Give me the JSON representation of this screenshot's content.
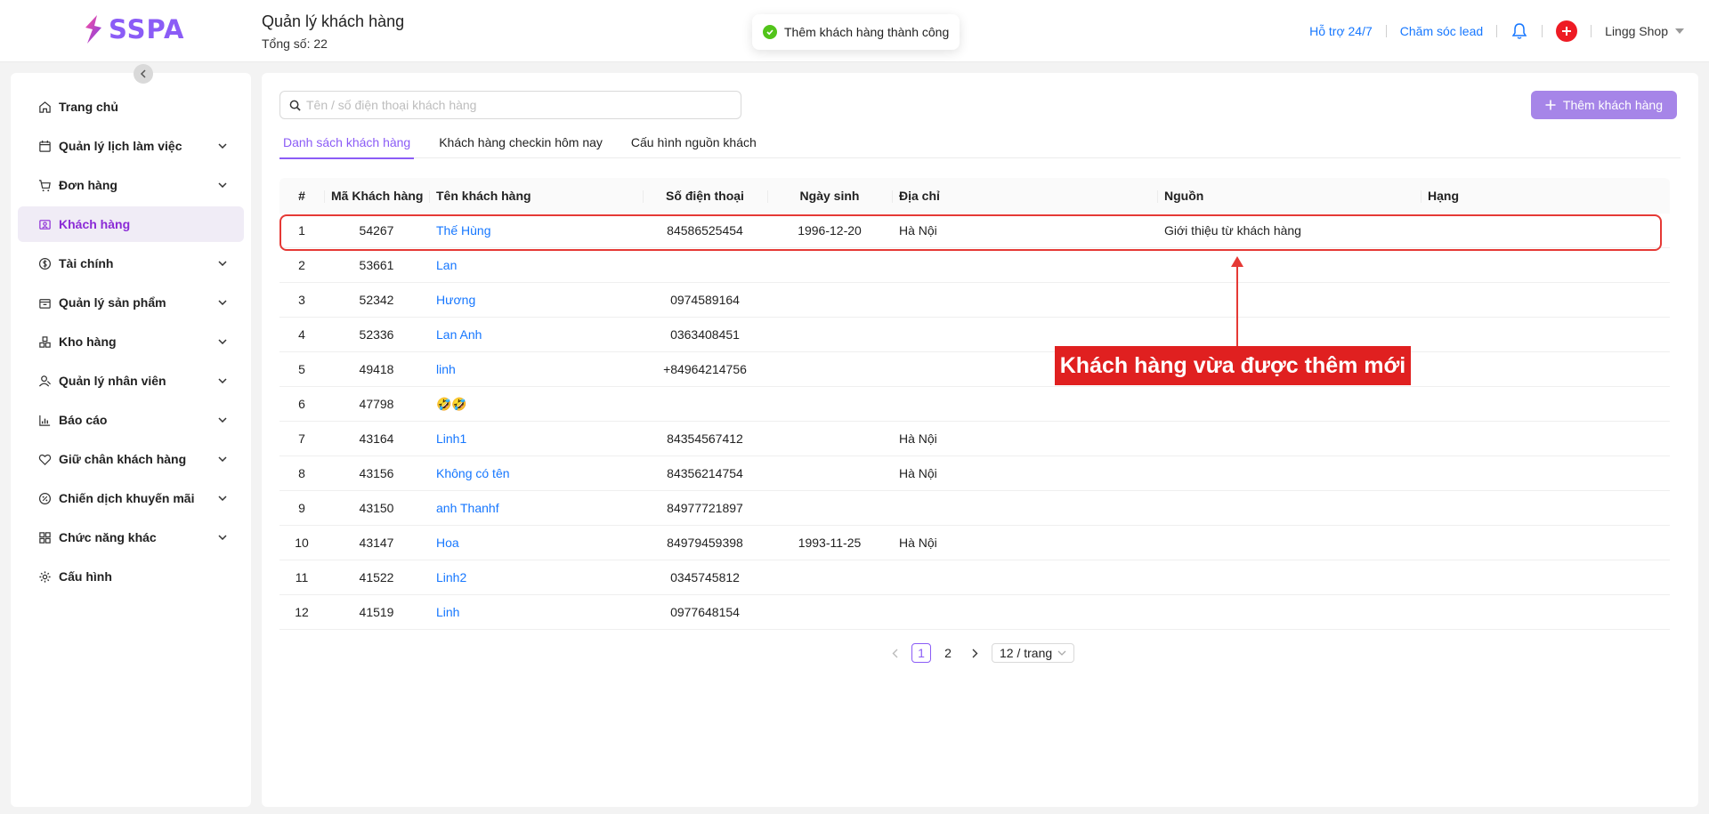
{
  "brand": {
    "name": "SSPA"
  },
  "header": {
    "title": "Quản lý khách hàng",
    "subtitle": "Tổng số: 22",
    "toast": "Thêm khách hàng thành công",
    "support_link": "Hỗ trợ 24/7",
    "lead_link": "Chăm sóc lead",
    "shop_name": "Lingg Shop"
  },
  "sidebar": {
    "items": [
      {
        "label": "Trang chủ",
        "icon": "home-icon"
      },
      {
        "label": "Quản lý lịch làm việc",
        "icon": "calendar-icon"
      },
      {
        "label": "Đơn hàng",
        "icon": "cart-icon"
      },
      {
        "label": "Khách hàng",
        "icon": "contact-icon"
      },
      {
        "label": "Tài chính",
        "icon": "dollar-icon"
      },
      {
        "label": "Quản lý sản phẩm",
        "icon": "box-icon"
      },
      {
        "label": "Kho hàng",
        "icon": "warehouse-icon"
      },
      {
        "label": "Quản lý nhân viên",
        "icon": "user-icon"
      },
      {
        "label": "Báo cáo",
        "icon": "chart-icon"
      },
      {
        "label": "Giữ chân khách hàng",
        "icon": "heart-icon"
      },
      {
        "label": "Chiến dịch khuyến mãi",
        "icon": "discount-icon"
      },
      {
        "label": "Chức năng khác",
        "icon": "grid-icon"
      },
      {
        "label": "Cấu hình",
        "icon": "gear-icon"
      }
    ]
  },
  "search": {
    "placeholder": "Tên / số điện thoại khách hàng"
  },
  "add_button": "Thêm khách hàng",
  "tabs": [
    {
      "label": "Danh sách khách hàng"
    },
    {
      "label": "Khách hàng checkin hôm nay"
    },
    {
      "label": "Cấu hình nguồn khách"
    }
  ],
  "table": {
    "columns": [
      "#",
      "Mã Khách hàng",
      "Tên khách hàng",
      "Số điện thoại",
      "Ngày sinh",
      "Địa chỉ",
      "Nguồn",
      "Hạng"
    ],
    "rows": [
      [
        "1",
        "54267",
        "Thế Hùng",
        "84586525454",
        "1996-12-20",
        "Hà Nội",
        "Giới thiệu từ khách hàng",
        ""
      ],
      [
        "2",
        "53661",
        "Lan",
        "",
        "",
        "",
        "",
        ""
      ],
      [
        "3",
        "52342",
        "Hương",
        "0974589164",
        "",
        "",
        "",
        ""
      ],
      [
        "4",
        "52336",
        "Lan Anh",
        "0363408451",
        "",
        "",
        "",
        ""
      ],
      [
        "5",
        "49418",
        "linh",
        "+84964214756",
        "",
        "",
        "",
        ""
      ],
      [
        "6",
        "47798",
        "🤣🤣",
        "",
        "",
        "",
        "",
        ""
      ],
      [
        "7",
        "43164",
        "Linh1",
        "84354567412",
        "",
        "Hà Nội",
        "",
        ""
      ],
      [
        "8",
        "43156",
        "Không có tên",
        "84356214754",
        "",
        "Hà Nội",
        "",
        ""
      ],
      [
        "9",
        "43150",
        "anh Thanhf",
        "84977721897",
        "",
        "",
        "",
        ""
      ],
      [
        "10",
        "43147",
        "Hoa",
        "84979459398",
        "1993-11-25",
        "Hà Nội",
        "",
        ""
      ],
      [
        "11",
        "41522",
        "Linh2",
        "0345745812",
        "",
        "",
        "",
        ""
      ],
      [
        "12",
        "41519",
        "Linh",
        "0977648154",
        "",
        "",
        "",
        ""
      ]
    ]
  },
  "annotation": "Khách hàng vừa được thêm mới",
  "pagination": {
    "pages": [
      "1",
      "2"
    ],
    "current": "1",
    "page_size": "12 / trang"
  },
  "colors": {
    "accent": "#8b5cf6",
    "link": "#1677ff",
    "annotation_red": "#e02020",
    "success": "#52c41a"
  }
}
